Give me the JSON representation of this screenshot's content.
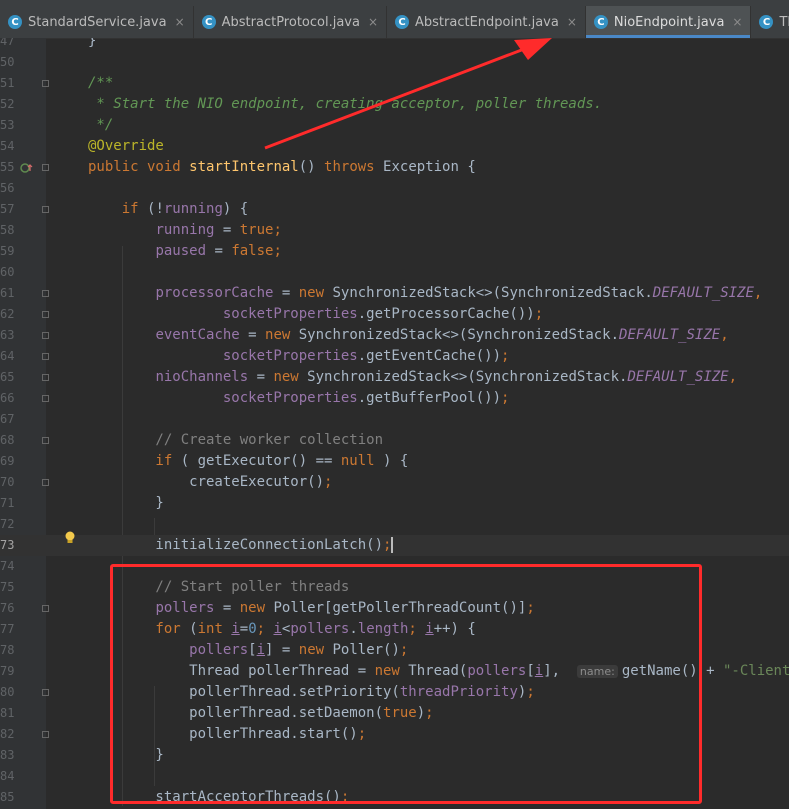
{
  "tabs": [
    {
      "label": "StandardService.java",
      "close": "×",
      "icon": "C",
      "active": false
    },
    {
      "label": "AbstractProtocol.java",
      "close": "×",
      "icon": "C",
      "active": false
    },
    {
      "label": "AbstractEndpoint.java",
      "close": "×",
      "icon": "C",
      "active": false
    },
    {
      "label": "NioEndpoint.java",
      "close": "×",
      "icon": "C",
      "active": true
    },
    {
      "label": "Thread.java",
      "close": "×",
      "icon": "C",
      "active": false
    }
  ],
  "gutter": {
    "current_line": "73"
  },
  "code_lines": [
    {
      "ln": "47",
      "segs": [
        {
          "t": "}",
          "c": ""
        }
      ]
    },
    {
      "ln": "50",
      "segs": []
    },
    {
      "ln": "51",
      "segs": [
        {
          "t": "/**",
          "c": "doc"
        }
      ]
    },
    {
      "ln": "52",
      "segs": [
        {
          "t": " * Start the NIO endpoint, creating acceptor, poller threads.",
          "c": "doc"
        }
      ]
    },
    {
      "ln": "53",
      "segs": [
        {
          "t": " */",
          "c": "doc"
        }
      ]
    },
    {
      "ln": "54",
      "segs": [
        {
          "t": "@Override",
          "c": "ann"
        }
      ]
    },
    {
      "ln": "55",
      "segs": [
        {
          "t": "public void ",
          "c": "kw"
        },
        {
          "t": "startInternal",
          "c": "fn"
        },
        {
          "t": "() ",
          "c": ""
        },
        {
          "t": "throws ",
          "c": "kw"
        },
        {
          "t": "Exception {",
          "c": ""
        }
      ]
    },
    {
      "ln": "56",
      "segs": []
    },
    {
      "ln": "57",
      "segs": [
        {
          "t": "    if ",
          "c": "kw"
        },
        {
          "t": "(!",
          "c": ""
        },
        {
          "t": "running",
          "c": "fd"
        },
        {
          "t": ") {",
          "c": ""
        }
      ]
    },
    {
      "ln": "58",
      "segs": [
        {
          "t": "        ",
          "c": ""
        },
        {
          "t": "running",
          "c": "fd"
        },
        {
          "t": " = ",
          "c": ""
        },
        {
          "t": "true",
          "c": "kw"
        },
        {
          "t": ";",
          "c": "kw"
        }
      ]
    },
    {
      "ln": "59",
      "segs": [
        {
          "t": "        ",
          "c": ""
        },
        {
          "t": "paused",
          "c": "fd"
        },
        {
          "t": " = ",
          "c": ""
        },
        {
          "t": "false",
          "c": "kw"
        },
        {
          "t": ";",
          "c": "kw"
        }
      ]
    },
    {
      "ln": "60",
      "segs": []
    },
    {
      "ln": "61",
      "segs": [
        {
          "t": "        ",
          "c": ""
        },
        {
          "t": "processorCache",
          "c": "fd"
        },
        {
          "t": " = ",
          "c": ""
        },
        {
          "t": "new ",
          "c": "kw"
        },
        {
          "t": "SynchronizedStack<>(SynchronizedStack.",
          "c": ""
        },
        {
          "t": "DEFAULT_SIZE",
          "c": "fdi"
        },
        {
          "t": ",",
          "c": "kw"
        }
      ]
    },
    {
      "ln": "62",
      "segs": [
        {
          "t": "                ",
          "c": ""
        },
        {
          "t": "socketProperties",
          "c": "fd"
        },
        {
          "t": ".getProcessorCache())",
          "c": ""
        },
        {
          "t": ";",
          "c": "kw"
        }
      ]
    },
    {
      "ln": "63",
      "segs": [
        {
          "t": "        ",
          "c": ""
        },
        {
          "t": "eventCache",
          "c": "fd"
        },
        {
          "t": " = ",
          "c": ""
        },
        {
          "t": "new ",
          "c": "kw"
        },
        {
          "t": "SynchronizedStack<>(SynchronizedStack.",
          "c": ""
        },
        {
          "t": "DEFAULT_SIZE",
          "c": "fdi"
        },
        {
          "t": ",",
          "c": "kw"
        }
      ]
    },
    {
      "ln": "64",
      "segs": [
        {
          "t": "                ",
          "c": ""
        },
        {
          "t": "socketProperties",
          "c": "fd"
        },
        {
          "t": ".getEventCache())",
          "c": ""
        },
        {
          "t": ";",
          "c": "kw"
        }
      ]
    },
    {
      "ln": "65",
      "segs": [
        {
          "t": "        ",
          "c": ""
        },
        {
          "t": "nioChannels",
          "c": "fd"
        },
        {
          "t": " = ",
          "c": ""
        },
        {
          "t": "new ",
          "c": "kw"
        },
        {
          "t": "SynchronizedStack<>(SynchronizedStack.",
          "c": ""
        },
        {
          "t": "DEFAULT_SIZE",
          "c": "fdi"
        },
        {
          "t": ",",
          "c": "kw"
        }
      ]
    },
    {
      "ln": "66",
      "segs": [
        {
          "t": "                ",
          "c": ""
        },
        {
          "t": "socketProperties",
          "c": "fd"
        },
        {
          "t": ".getBufferPool())",
          "c": ""
        },
        {
          "t": ";",
          "c": "kw"
        }
      ]
    },
    {
      "ln": "67",
      "segs": []
    },
    {
      "ln": "68",
      "segs": [
        {
          "t": "        // Create worker collection",
          "c": "cm"
        }
      ]
    },
    {
      "ln": "69",
      "segs": [
        {
          "t": "        if ",
          "c": "kw"
        },
        {
          "t": "( getExecutor() == ",
          "c": ""
        },
        {
          "t": "null",
          "c": "kw"
        },
        {
          "t": " ) {",
          "c": ""
        }
      ]
    },
    {
      "ln": "70",
      "segs": [
        {
          "t": "            createExecutor()",
          "c": ""
        },
        {
          "t": ";",
          "c": "kw"
        }
      ]
    },
    {
      "ln": "71",
      "segs": [
        {
          "t": "        }",
          "c": ""
        }
      ]
    },
    {
      "ln": "72",
      "segs": []
    },
    {
      "ln": "73",
      "segs": [
        {
          "t": "        initializeConnectionLatch()",
          "c": ""
        },
        {
          "t": ";",
          "c": "kw"
        },
        {
          "t": "",
          "c": "caret"
        }
      ]
    },
    {
      "ln": "74",
      "segs": []
    },
    {
      "ln": "75",
      "segs": [
        {
          "t": "        // Start poller threads",
          "c": "cm"
        }
      ]
    },
    {
      "ln": "76",
      "segs": [
        {
          "t": "        ",
          "c": ""
        },
        {
          "t": "pollers",
          "c": "fd"
        },
        {
          "t": " = ",
          "c": ""
        },
        {
          "t": "new ",
          "c": "kw"
        },
        {
          "t": "Poller[getPollerThreadCount()]",
          "c": ""
        },
        {
          "t": ";",
          "c": "kw"
        }
      ]
    },
    {
      "ln": "77",
      "segs": [
        {
          "t": "        for ",
          "c": "kw"
        },
        {
          "t": "(",
          "c": ""
        },
        {
          "t": "int ",
          "c": "kw"
        },
        {
          "t": "i",
          "c": "u"
        },
        {
          "t": "=",
          "c": ""
        },
        {
          "t": "0",
          "c": "num"
        },
        {
          "t": "; ",
          "c": "kw"
        },
        {
          "t": "i",
          "c": "u"
        },
        {
          "t": "<",
          "c": ""
        },
        {
          "t": "pollers",
          "c": "fd"
        },
        {
          "t": ".",
          "c": ""
        },
        {
          "t": "length",
          "c": "fd"
        },
        {
          "t": "; ",
          "c": "kw"
        },
        {
          "t": "i",
          "c": "u"
        },
        {
          "t": "++) {",
          "c": ""
        }
      ]
    },
    {
      "ln": "78",
      "segs": [
        {
          "t": "            ",
          "c": ""
        },
        {
          "t": "pollers",
          "c": "fd"
        },
        {
          "t": "[",
          "c": ""
        },
        {
          "t": "i",
          "c": "u"
        },
        {
          "t": "] = ",
          "c": ""
        },
        {
          "t": "new ",
          "c": "kw"
        },
        {
          "t": "Poller()",
          "c": ""
        },
        {
          "t": ";",
          "c": "kw"
        }
      ]
    },
    {
      "ln": "79",
      "segs": [
        {
          "t": "            Thread pollerThread = ",
          "c": ""
        },
        {
          "t": "new ",
          "c": "kw"
        },
        {
          "t": "Thread(",
          "c": ""
        },
        {
          "t": "pollers",
          "c": "fd"
        },
        {
          "t": "[",
          "c": ""
        },
        {
          "t": "i",
          "c": "u"
        },
        {
          "t": "],  ",
          "c": ""
        },
        {
          "t": "name:",
          "c": "hint"
        },
        {
          "t": "getName() + ",
          "c": ""
        },
        {
          "t": "\"-ClientPoller-\"",
          "c": "str"
        }
      ]
    },
    {
      "ln": "80",
      "segs": [
        {
          "t": "            pollerThread.setPriority(",
          "c": ""
        },
        {
          "t": "threadPriority",
          "c": "fd"
        },
        {
          "t": ")",
          "c": ""
        },
        {
          "t": ";",
          "c": "kw"
        }
      ]
    },
    {
      "ln": "81",
      "segs": [
        {
          "t": "            pollerThread.setDaemon(",
          "c": ""
        },
        {
          "t": "true",
          "c": "kw"
        },
        {
          "t": ")",
          "c": ""
        },
        {
          "t": ";",
          "c": "kw"
        }
      ]
    },
    {
      "ln": "82",
      "segs": [
        {
          "t": "            pollerThread.start()",
          "c": ""
        },
        {
          "t": ";",
          "c": "kw"
        }
      ]
    },
    {
      "ln": "83",
      "segs": [
        {
          "t": "        }",
          "c": ""
        }
      ]
    },
    {
      "ln": "84",
      "segs": []
    },
    {
      "ln": "85",
      "segs": [
        {
          "t": "        startAcceptorThreads()",
          "c": ""
        },
        {
          "t": ";",
          "c": "kw"
        }
      ]
    }
  ]
}
